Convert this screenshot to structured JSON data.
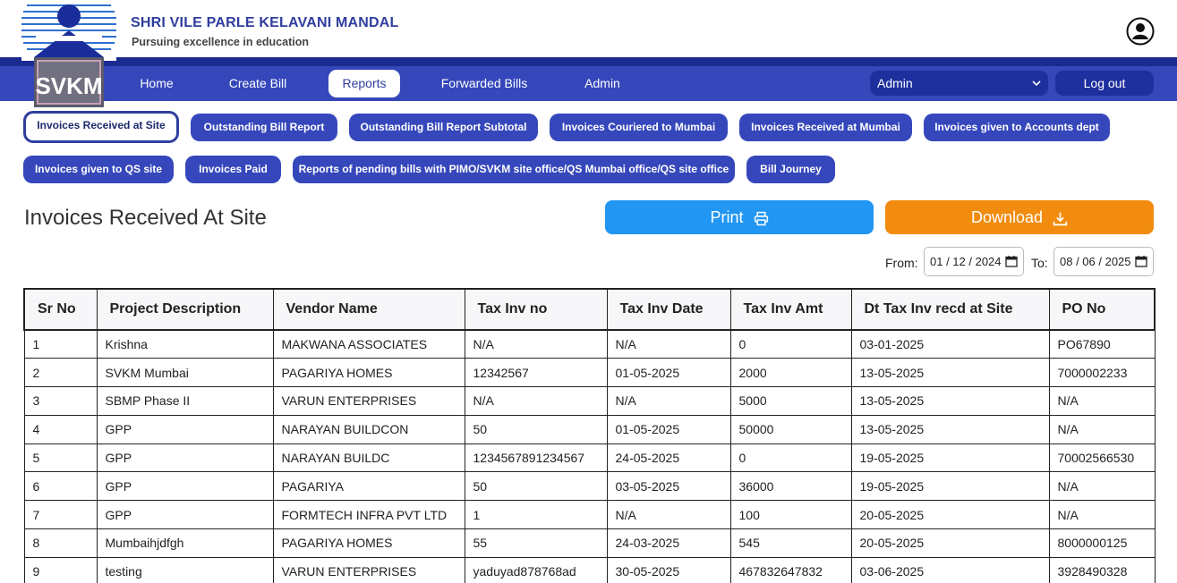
{
  "header": {
    "org_name": "SHRI VILE PARLE KELAVANI MANDAL",
    "tagline": "Pursuing excellence in education",
    "logo_text": "SVKM",
    "colors": {
      "brand_blue": "#3547bb",
      "dark_blue": "#1b2a8e",
      "print": "#2196f3",
      "download": "#f28c0f"
    }
  },
  "nav": {
    "items": [
      {
        "label": "Home"
      },
      {
        "label": "Create Bill"
      },
      {
        "label": "Reports"
      },
      {
        "label": "Forwarded Bills"
      },
      {
        "label": "Admin"
      }
    ],
    "active": "Reports",
    "role_select": "Admin",
    "logout": "Log out"
  },
  "reports": {
    "pills": [
      {
        "label": "Invoices Received at Site"
      },
      {
        "label": "Outstanding Bill Report"
      },
      {
        "label": "Outstanding Bill Report Subtotal"
      },
      {
        "label": "Invoices Couriered to Mumbai"
      },
      {
        "label": "Invoices Received at Mumbai"
      },
      {
        "label": "Invoices given to Accounts dept"
      },
      {
        "label": "Invoices given to QS site"
      },
      {
        "label": "Invoices Paid"
      },
      {
        "label": "Reports of pending bills with PIMO/SVKM site office/QS Mumbai office/QS site office"
      },
      {
        "label": "Bill Journey"
      }
    ],
    "active": "Invoices Received at Site"
  },
  "main": {
    "title": "Invoices Received At Site",
    "print_label": "Print",
    "download_label": "Download",
    "from_label": "From:",
    "from_value": "01 / 12 / 2024",
    "to_label": "To:",
    "to_value": "08 / 06 / 2025"
  },
  "table": {
    "columns": [
      "Sr No",
      "Project Description",
      "Vendor Name",
      "Tax Inv no",
      "Tax Inv Date",
      "Tax Inv Amt",
      "Dt Tax Inv recd at Site",
      "PO No"
    ],
    "rows": [
      [
        "1",
        "Krishna",
        "MAKWANA ASSOCIATES",
        "N/A",
        "N/A",
        "0",
        "03-01-2025",
        "PO67890"
      ],
      [
        "2",
        "SVKM Mumbai",
        "PAGARIYA HOMES",
        "12342567",
        "01-05-2025",
        "2000",
        "13-05-2025",
        "7000002233"
      ],
      [
        "3",
        "SBMP Phase II",
        "VARUN ENTERPRISES",
        "N/A",
        "N/A",
        "5000",
        "13-05-2025",
        "N/A"
      ],
      [
        "4",
        "GPP",
        "NARAYAN BUILDCON",
        "50",
        "01-05-2025",
        "50000",
        "13-05-2025",
        "N/A"
      ],
      [
        "5",
        "GPP",
        "NARAYAN BUILDC",
        "1234567891234567",
        "24-05-2025",
        "0",
        "19-05-2025",
        "70002566530"
      ],
      [
        "6",
        "GPP",
        "PAGARIYA",
        "50",
        "03-05-2025",
        "36000",
        "19-05-2025",
        "N/A"
      ],
      [
        "7",
        "GPP",
        "FORMTECH INFRA PVT LTD",
        "1",
        "N/A",
        "100",
        "20-05-2025",
        "N/A"
      ],
      [
        "8",
        "Mumbaihjdfgh",
        "PAGARIYA HOMES",
        "55",
        "24-03-2025",
        "545",
        "20-05-2025",
        "8000000125"
      ],
      [
        "9",
        "testing",
        "VARUN ENTERPRISES",
        "yaduyad878768ad",
        "30-05-2025",
        "467832647832",
        "03-06-2025",
        "3928490328"
      ]
    ]
  }
}
